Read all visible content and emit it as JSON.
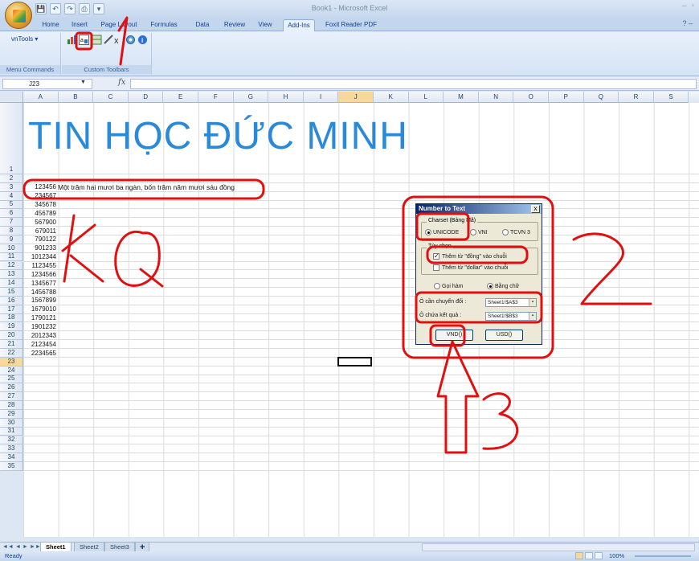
{
  "window": {
    "title": "Book1 - Microsoft Excel",
    "controls": [
      "–",
      "▫"
    ]
  },
  "qat": {
    "save_icon": "💾",
    "undo_icon": "↶",
    "redo_icon": "↷",
    "print_icon": "⎙",
    "more_icon": "▾"
  },
  "tabs": [
    {
      "label": "Home"
    },
    {
      "label": "Insert"
    },
    {
      "label": "Page Layout"
    },
    {
      "label": "Formulas"
    },
    {
      "label": "Data"
    },
    {
      "label": "Review"
    },
    {
      "label": "View"
    },
    {
      "label": "Add-Ins"
    },
    {
      "label": "Foxit Reader PDF"
    }
  ],
  "ribbon": {
    "vntools_label": "vnTools",
    "groups": [
      {
        "label": "Menu Commands"
      },
      {
        "label": "Custom Toolbars"
      }
    ],
    "help_icon": "?",
    "min_icon": "–"
  },
  "formula_bar": {
    "namebox": "J23",
    "fx": "fx",
    "value": ""
  },
  "columns": [
    "A",
    "B",
    "C",
    "D",
    "E",
    "F",
    "G",
    "H",
    "I",
    "J",
    "K",
    "L",
    "M",
    "N",
    "O",
    "P",
    "Q",
    "R",
    "S"
  ],
  "selected_column": "J",
  "selected_row": "23",
  "rows": [
    "1",
    "2",
    "3",
    "4",
    "5",
    "6",
    "7",
    "8",
    "9",
    "10",
    "11",
    "12",
    "13",
    "14",
    "15",
    "16",
    "17",
    "18",
    "19",
    "20",
    "21",
    "22",
    "23",
    "24",
    "25",
    "26",
    "27",
    "28",
    "29",
    "30",
    "31",
    "32",
    "33",
    "34",
    "35"
  ],
  "sheet": {
    "title": "TIN HỌC ĐỨC MINH",
    "b3": "Một trăm hai mươi ba ngàn, bốn trăm năm mươi sáu đồng",
    "column_a": [
      "123456",
      "234567",
      "345678",
      "456789",
      "567900",
      "679011",
      "790122",
      "901233",
      "1012344",
      "1123455",
      "1234566",
      "1345677",
      "1456788",
      "1567899",
      "1679010",
      "1790121",
      "1901232",
      "2012343",
      "2123454",
      "2234565"
    ]
  },
  "dialog": {
    "title": "Number to Text",
    "close": "x",
    "charset_legend": "Charset (Bảng Mã)",
    "charset_options": [
      "UNICODE",
      "VNI",
      "TCVN 3"
    ],
    "charset_selected": 0,
    "options_legend": "Tùy chọn",
    "check_dong": "Thêm từ \"đồng\" vào chuỗi",
    "check_dollar": "Thêm từ \"dollar\" vào chuỗi",
    "check_dong_checked": true,
    "mode_options": [
      "Gọi hàm",
      "Bằng chữ"
    ],
    "mode_selected": 1,
    "source_label": "Ô cần chuyển đổi :",
    "source_value": "Sheet1!$A$3",
    "target_label": "Ô chứa kết quả :",
    "target_value": "Sheet1!$B$3",
    "btn_vnd": "VND()",
    "btn_usd": "USD()"
  },
  "annotations": {
    "one": "1",
    "two": "2",
    "three": "3",
    "kq": "KQ"
  },
  "sheet_tabs": [
    {
      "label": "Sheet1"
    },
    {
      "label": "Sheet2"
    },
    {
      "label": "Sheet3"
    }
  ],
  "nav_arrows": [
    "◄◄",
    "◄",
    "►",
    "►►"
  ],
  "status": {
    "ready": "Ready",
    "zoom": "100%"
  },
  "colors": {
    "title_blue": "#2a8ad8",
    "annotation_red": "#e01010",
    "selection": "#f9d99a"
  }
}
